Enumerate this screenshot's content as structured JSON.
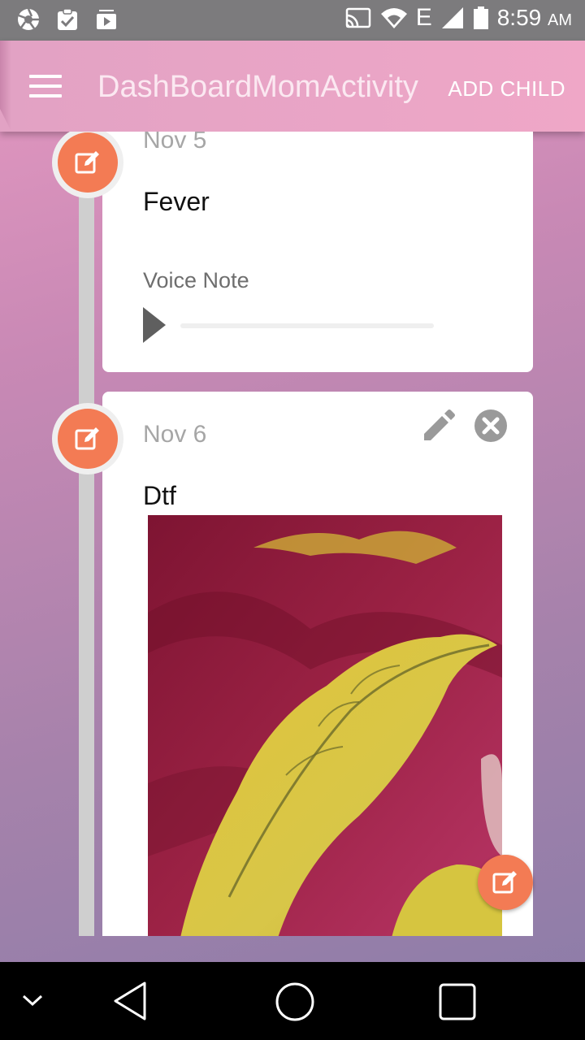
{
  "status_bar": {
    "time": "8:59",
    "ampm": "AM",
    "network": "E",
    "left_icons": [
      "aperture-icon",
      "clipboard-check-icon",
      "media-play-icon"
    ],
    "right_icons": [
      "cast-icon",
      "wifi-icon",
      "signal-icon",
      "battery-icon"
    ]
  },
  "app_bar": {
    "title": "DashBoardMomActivity",
    "add_child_label": "ADD CHILD"
  },
  "timeline": {
    "entries": [
      {
        "date": "Nov 5",
        "title": "Fever",
        "voice_note_label": "Voice Note",
        "playback_progress": 0
      },
      {
        "date": "Nov 6",
        "title": "Dtf",
        "attachment": "photo"
      }
    ]
  },
  "colors": {
    "accent": "#f37b54",
    "app_bar": "#efa7c7",
    "status_bar": "#7c7b7d"
  }
}
